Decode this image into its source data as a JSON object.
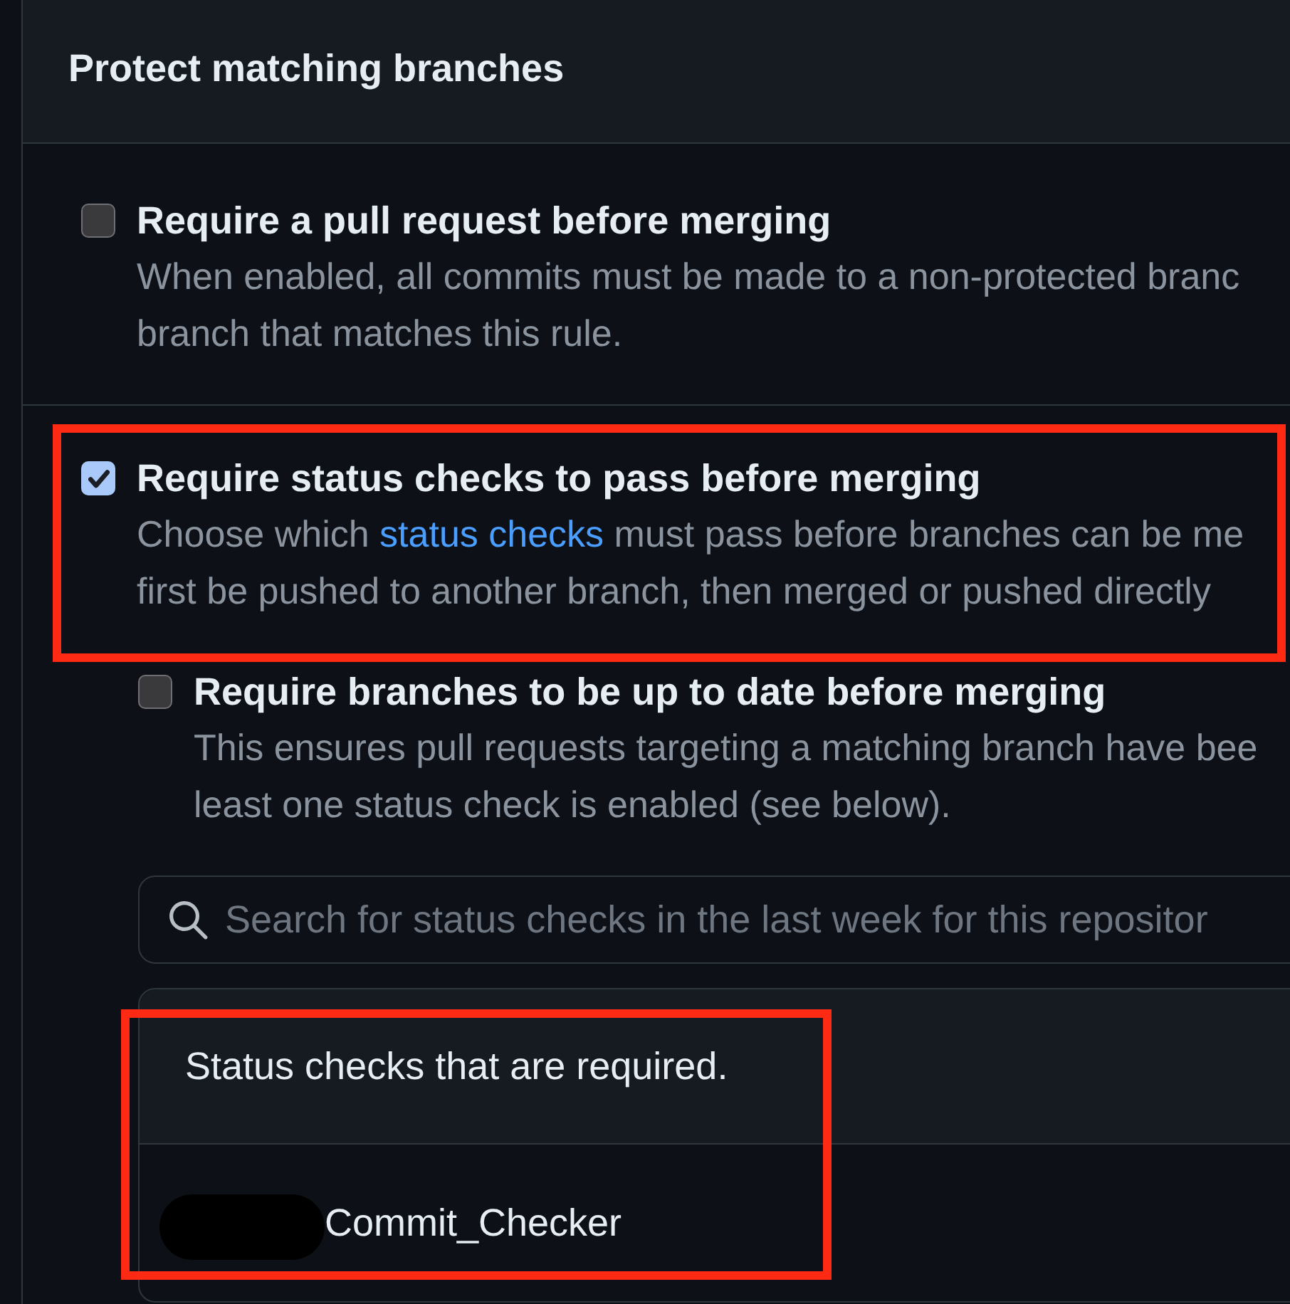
{
  "section": {
    "title": "Protect matching branches"
  },
  "options": [
    {
      "title": "Require a pull request before merging",
      "checked": false,
      "highlighted": false,
      "description": [
        {
          "parts": [
            {
              "kind": "text",
              "text": "When enabled, all commits must be made to a non-protected branc"
            }
          ]
        },
        {
          "parts": [
            {
              "kind": "text",
              "text": "branch that matches this rule."
            }
          ]
        }
      ]
    },
    {
      "title": "Require status checks to pass before merging",
      "checked": true,
      "highlighted": true,
      "description": [
        {
          "parts": [
            {
              "kind": "text",
              "text": "Choose which "
            },
            {
              "kind": "link",
              "text": "status checks"
            },
            {
              "kind": "text",
              "text": " must pass before branches can be me"
            }
          ]
        },
        {
          "parts": [
            {
              "kind": "text",
              "text": "first be pushed to another branch, then merged or pushed directly"
            }
          ]
        }
      ],
      "children": [
        {
          "title": "Require branches to be up to date before merging",
          "checked": false,
          "highlighted": false,
          "description": [
            {
              "parts": [
                {
                  "kind": "text",
                  "text": "This ensures pull requests targeting a matching branch have bee"
                }
              ]
            },
            {
              "parts": [
                {
                  "kind": "text",
                  "text": "least one status check is enabled (see below)."
                }
              ]
            }
          ]
        }
      ],
      "search": {
        "placeholder": "Search for status checks in the last week for this repositor"
      },
      "required_checks": {
        "title": "Status checks that are required.",
        "highlighted": true,
        "items": [
          {
            "name": "Commit_Checker",
            "redacted": true
          }
        ]
      }
    }
  ]
}
